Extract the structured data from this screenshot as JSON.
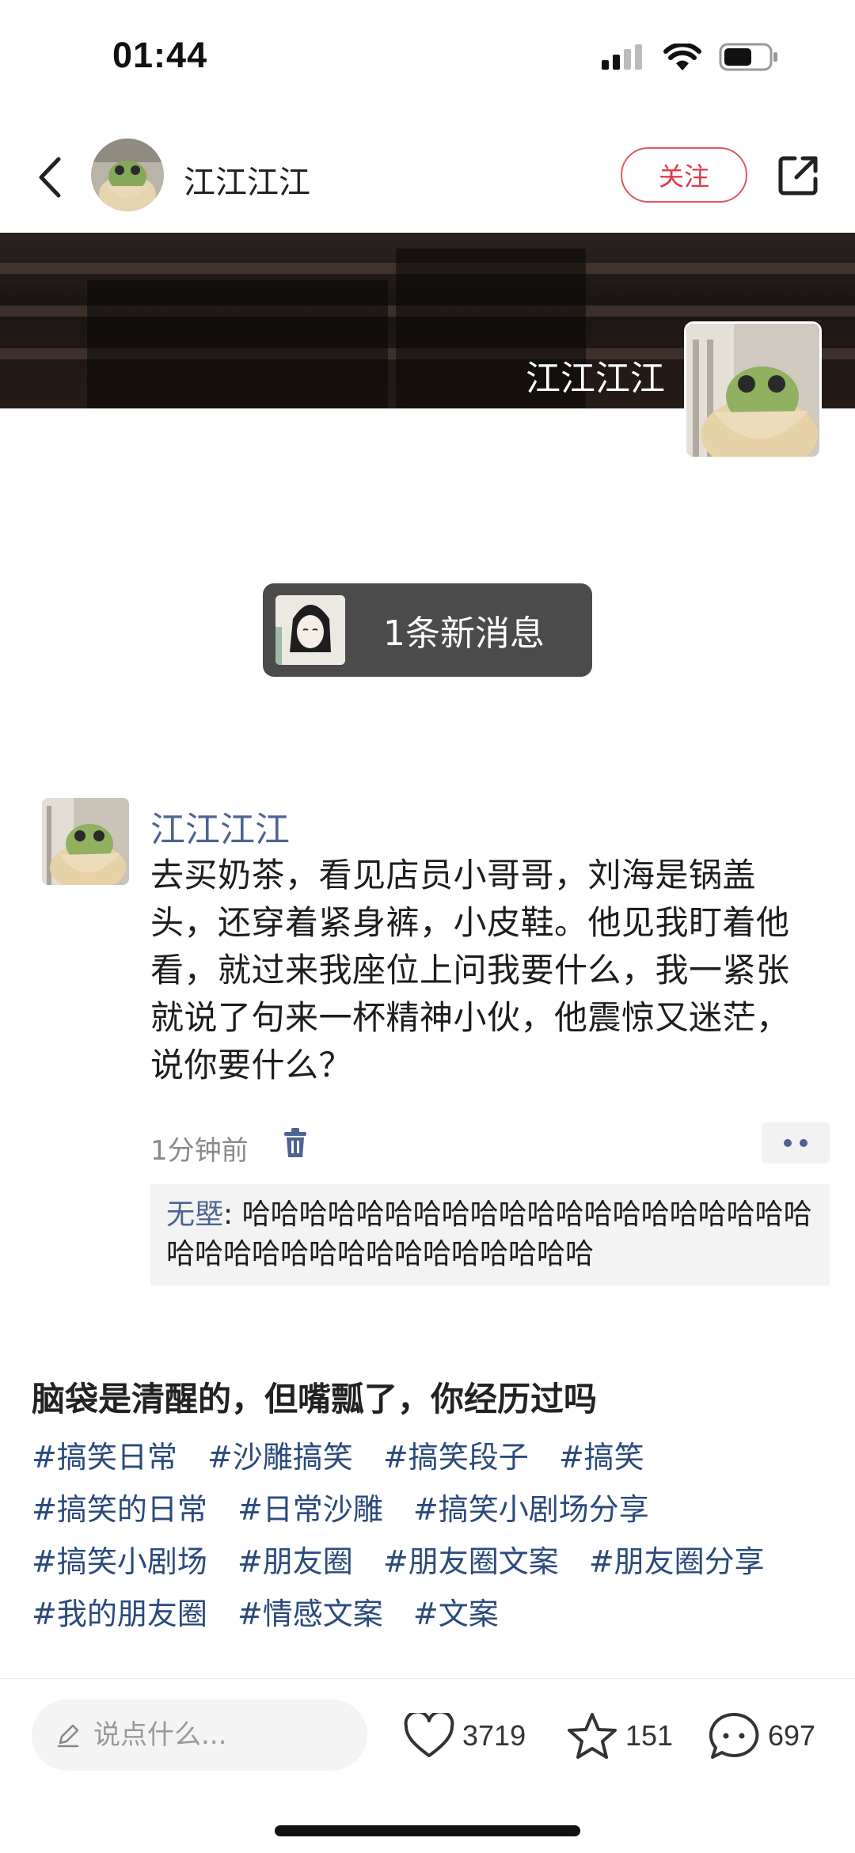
{
  "status_bar": {
    "time": "01:44"
  },
  "nav": {
    "author_name": "江江江江",
    "follow_label": "关注"
  },
  "cover": {
    "name": "江江江江"
  },
  "notification": {
    "text": "1条新消息"
  },
  "post": {
    "author": "江江江江",
    "text": "去买奶茶，看见店员小哥哥，刘海是锅盖头，还穿着紧身裤，小皮鞋。他见我盯着他看，就过来我座位上问我要什么，我一紧张就说了句来一杯精神小伙，他震惊又迷茫，说你要什么？",
    "time": "1分钟前",
    "reply": {
      "name": "无塈",
      "separator": ": ",
      "text": "哈哈哈哈哈哈哈哈哈哈哈哈哈哈哈哈哈哈哈哈哈哈哈哈哈哈哈哈哈哈哈哈哈哈哈"
    }
  },
  "caption": {
    "title": "脑袋是清醒的，但嘴瓢了，你经历过吗",
    "tags": [
      "#搞笑日常",
      "#沙雕搞笑",
      "#搞笑段子",
      "#搞笑",
      "#搞笑的日常",
      "#日常沙雕",
      "#搞笑小剧场分享",
      "#搞笑小剧场",
      "#朋友圈",
      "#朋友圈文案",
      "#朋友圈分享",
      "#我的朋友圈",
      "#情感文案",
      "#文案"
    ]
  },
  "bottom_bar": {
    "comment_placeholder": "说点什么...",
    "likes": "3719",
    "favorites": "151",
    "comments": "697"
  },
  "colors": {
    "accent_red": "#e0394a",
    "link_blue": "#4e6391",
    "tag_blue": "#2b4a7c"
  },
  "icons": [
    "back-icon",
    "share-icon",
    "trash-icon",
    "more-icon",
    "pencil-icon",
    "heart-icon",
    "star-icon",
    "comment-icon",
    "signal-icon",
    "wifi-icon",
    "battery-icon"
  ]
}
